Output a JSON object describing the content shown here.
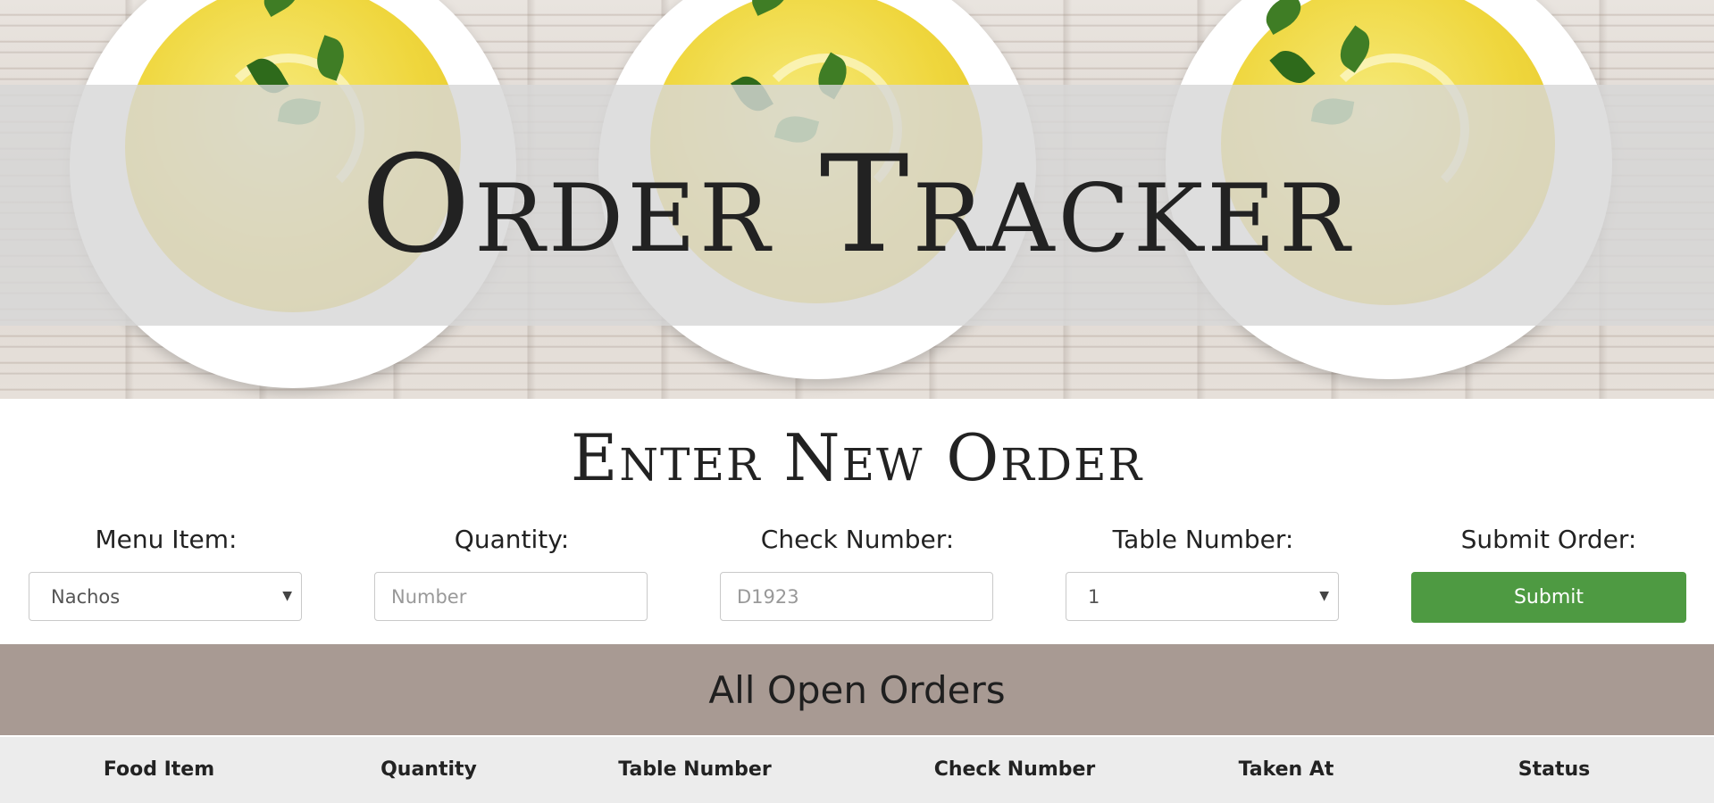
{
  "header": {
    "title": "Order Tracker"
  },
  "form": {
    "title": "Enter New Order",
    "fields": [
      {
        "label": "Menu Item:",
        "value": "Nachos",
        "kind": "select"
      },
      {
        "label": "Quantity:",
        "placeholder": "Number",
        "kind": "input"
      },
      {
        "label": "Check Number:",
        "placeholder": "D1923",
        "kind": "input"
      },
      {
        "label": "Table Number:",
        "value": "1",
        "kind": "select"
      }
    ],
    "submit": {
      "label": "Submit Order:",
      "button": "Submit"
    }
  },
  "orders": {
    "title": "All Open Orders",
    "columns": [
      "Food Item",
      "Quantity",
      "Table Number",
      "Check Number",
      "Taken At",
      "Status"
    ]
  },
  "colors": {
    "submit_button": "#4e9a42",
    "orders_band": "#a89a93",
    "table_header": "#ececec"
  }
}
